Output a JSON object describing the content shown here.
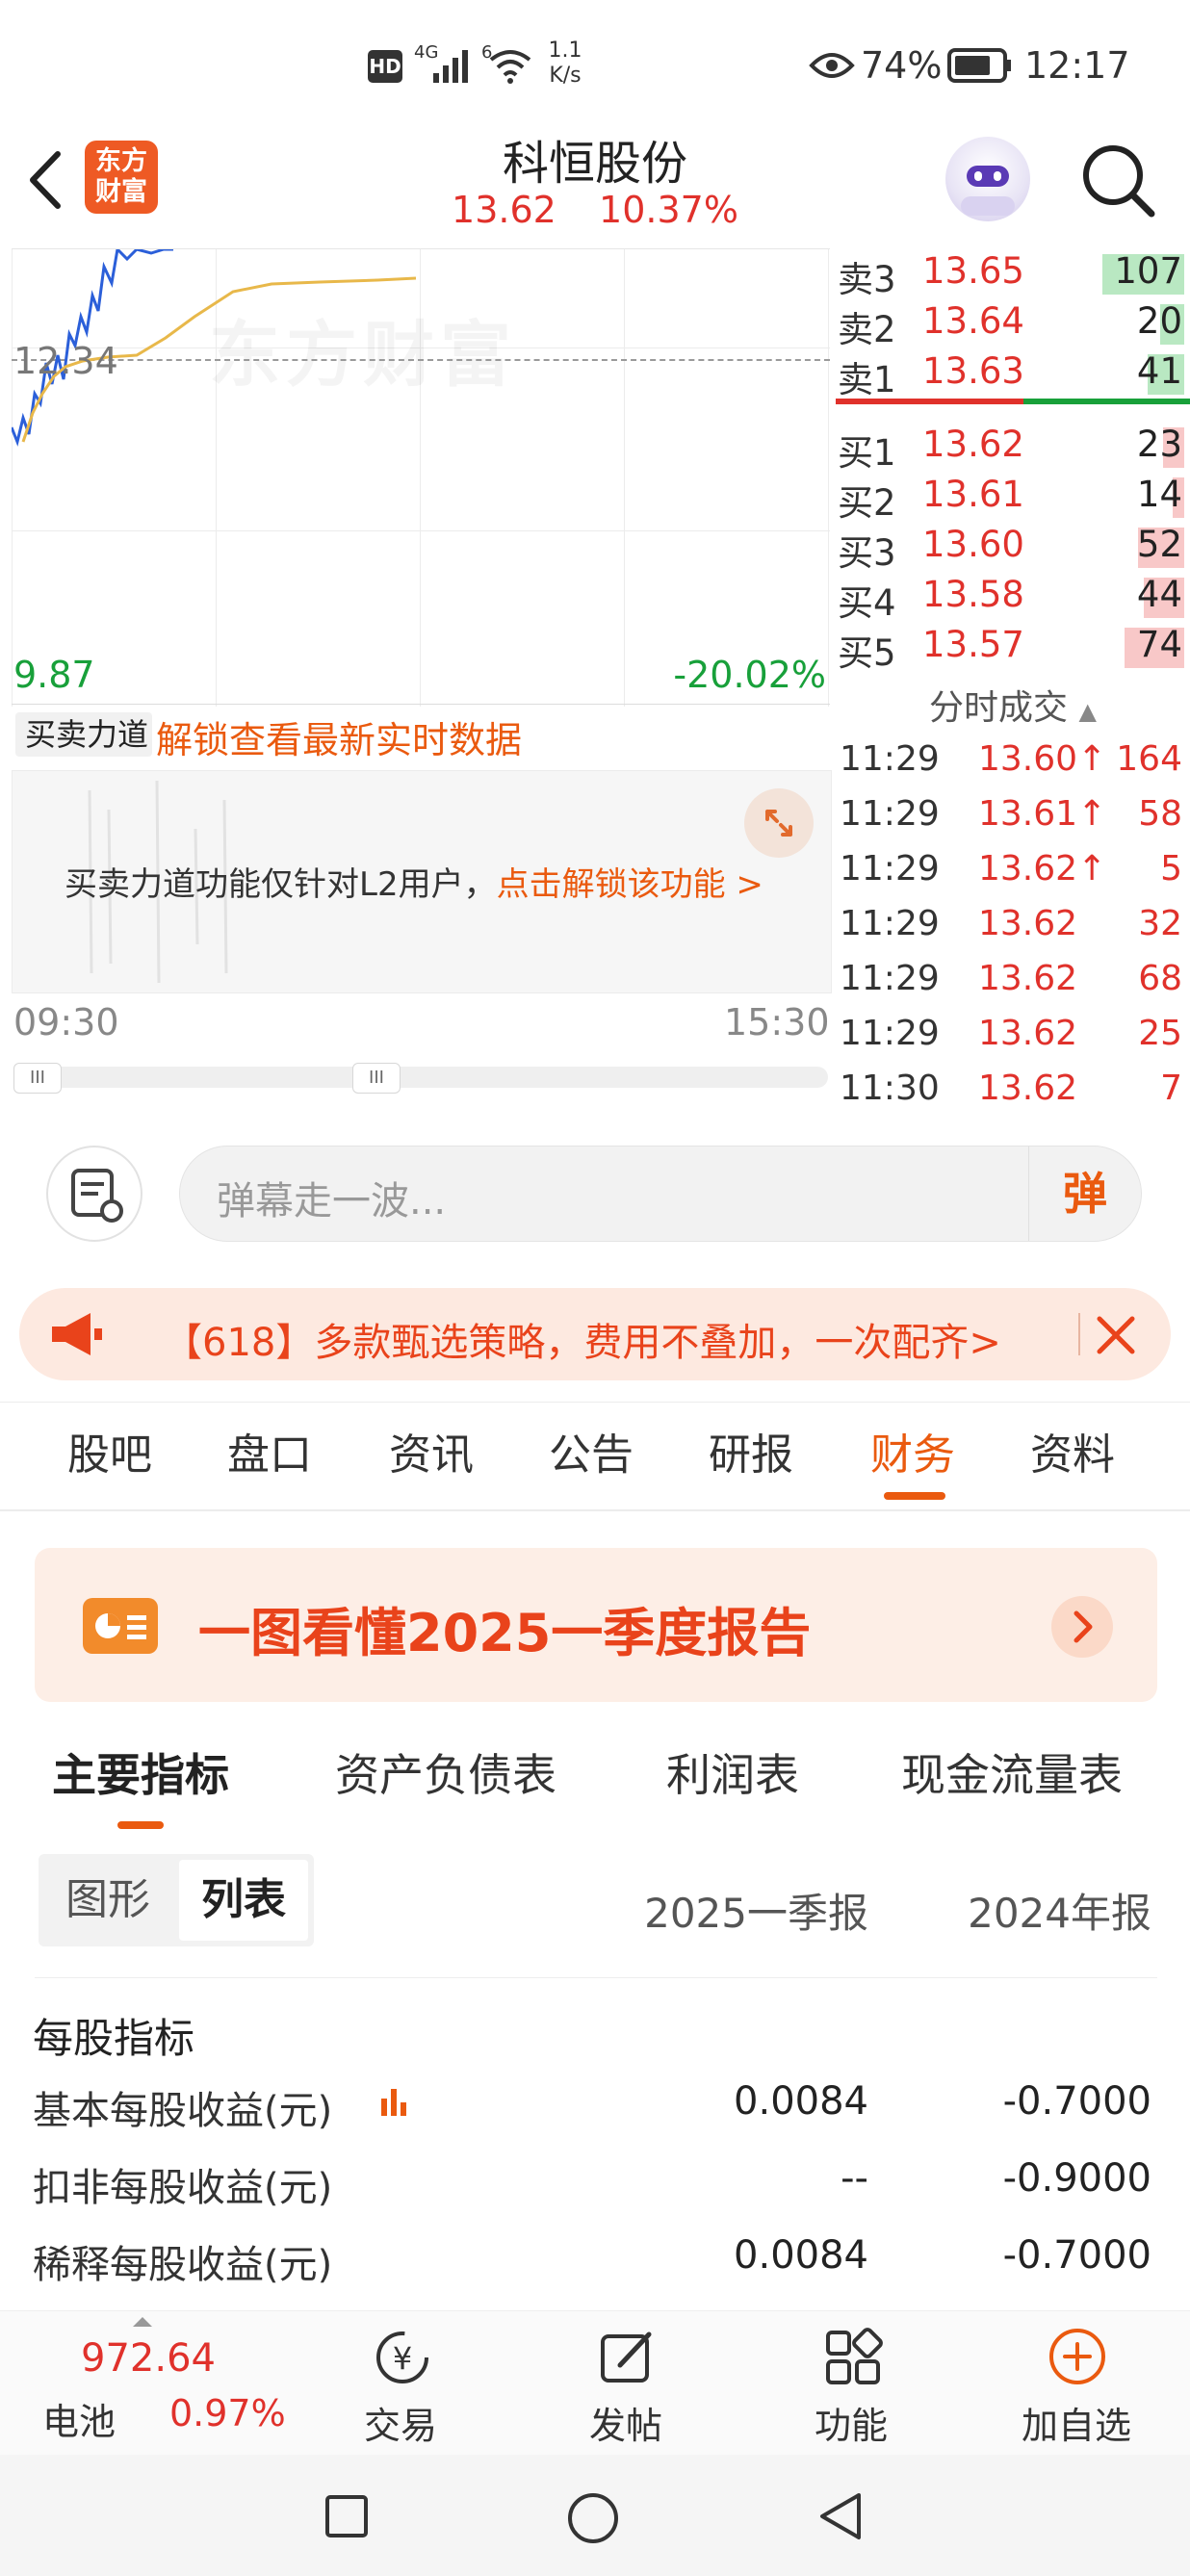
{
  "status_bar": {
    "hd": "HD",
    "network": "4G",
    "wifi_num": "6",
    "speed_value": "1.1",
    "speed_unit": "K/s",
    "battery": "74%",
    "time": "12:17"
  },
  "header": {
    "logo_line1": "东方",
    "logo_line2": "财富",
    "title": "科恒股份",
    "price": "13.62",
    "change_pct": "10.37%"
  },
  "chart": {
    "ref_price_label": "12.34",
    "low_label": "9.87",
    "low_pct": "-20.02%",
    "watermark": "东方财富",
    "time_start": "09:30",
    "time_end": "15:30",
    "indicator_select": "买卖力道",
    "unlock_link": "解锁查看最新实时数据",
    "locked_msg": "买卖力道功能仅针对L2用户，",
    "locked_link": "点击解锁该功能 >"
  },
  "order_book": {
    "asks": [
      {
        "label": "卖3",
        "price": "13.65",
        "vol": "107",
        "fill": 0.85
      },
      {
        "label": "卖2",
        "price": "13.64",
        "vol": "20",
        "fill": 0.25
      },
      {
        "label": "卖1",
        "price": "13.63",
        "vol": "41",
        "fill": 0.38
      }
    ],
    "bids": [
      {
        "label": "买1",
        "price": "13.62",
        "vol": "23",
        "fill": 0.22
      },
      {
        "label": "买2",
        "price": "13.61",
        "vol": "14",
        "fill": 0.12
      },
      {
        "label": "买3",
        "price": "13.60",
        "vol": "52",
        "fill": 0.48
      },
      {
        "label": "买4",
        "price": "13.58",
        "vol": "44",
        "fill": 0.42
      },
      {
        "label": "买5",
        "price": "13.57",
        "vol": "74",
        "fill": 0.62
      }
    ],
    "trades_header": "分时成交",
    "trades": [
      {
        "time": "11:29",
        "price": "13.60",
        "arrow": "↑",
        "vol": "164"
      },
      {
        "time": "11:29",
        "price": "13.61",
        "arrow": "↑",
        "vol": "58"
      },
      {
        "time": "11:29",
        "price": "13.62",
        "arrow": "↑",
        "vol": "5"
      },
      {
        "time": "11:29",
        "price": "13.62",
        "arrow": "",
        "vol": "32"
      },
      {
        "time": "11:29",
        "price": "13.62",
        "arrow": "",
        "vol": "68"
      },
      {
        "time": "11:29",
        "price": "13.62",
        "arrow": "",
        "vol": "25"
      },
      {
        "time": "11:30",
        "price": "13.62",
        "arrow": "",
        "vol": "7"
      }
    ]
  },
  "danmaku": {
    "placeholder": "弹幕走一波...",
    "button": "弹"
  },
  "promo": {
    "text": "【618】多款甄选策略，费用不叠加，一次配齐>"
  },
  "tabs": [
    "股吧",
    "盘口",
    "资讯",
    "公告",
    "研报",
    "财务",
    "资料"
  ],
  "active_tab": "财务",
  "report_banner": {
    "text": "一图看懂2025一季度报告"
  },
  "finance_tabs": [
    "主要指标",
    "资产负债表",
    "利润表",
    "现金流量表"
  ],
  "view_toggle": {
    "graph": "图形",
    "list": "列表"
  },
  "columns": [
    "2025一季报",
    "2024年报"
  ],
  "section_title": "每股指标",
  "rows": [
    {
      "label": "基本每股收益(元)",
      "v1": "0.0084",
      "v2": "-0.7000"
    },
    {
      "label": "扣非每股收益(元)",
      "v1": "--",
      "v2": "-0.9000"
    },
    {
      "label": "稀释每股收益(元)",
      "v1": "0.0084",
      "v2": "-0.7000"
    }
  ],
  "bottom_bar": {
    "index_value": "972.64",
    "index_name": "电池",
    "index_pct": "0.97%",
    "items": [
      "交易",
      "发帖",
      "功能",
      "加自选"
    ]
  }
}
